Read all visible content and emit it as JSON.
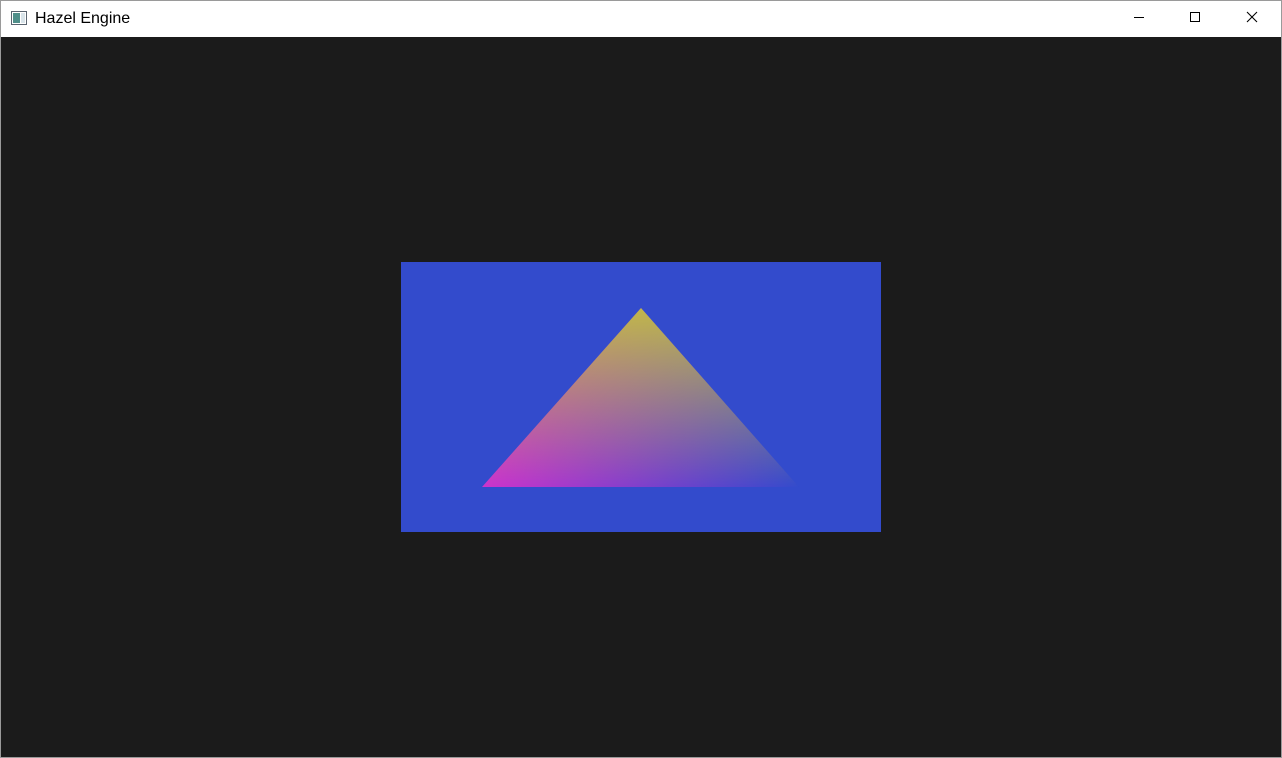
{
  "window": {
    "title": "Hazel Engine",
    "app_icon": "window-app-icon",
    "controls": {
      "minimize_icon": "minimize-icon",
      "maximize_icon": "maximize-icon",
      "close_icon": "close-icon"
    }
  },
  "viewport": {
    "clear_color": "#1b1b1b",
    "quad_color": "#334bcc",
    "triangle_vertex_colors": {
      "top": "#cccc33",
      "bottom_left": "#cc33cc",
      "bottom_right": "#334bcc"
    }
  }
}
